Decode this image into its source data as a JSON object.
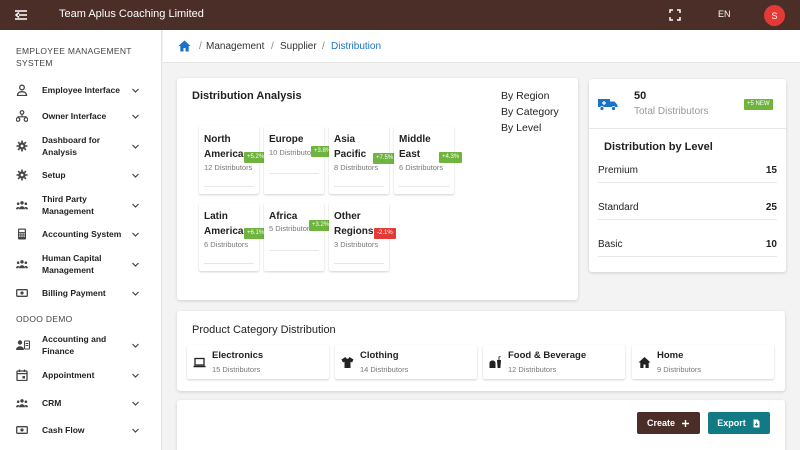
{
  "header": {
    "title": "Team Aplus Coaching Limited",
    "language": "EN",
    "avatar_initial": "S",
    "menu_icon": "menu-collapse-icon",
    "fullscreen_icon": "fullscreen-icon"
  },
  "sidebar": {
    "section_1": "EMPLOYEE MANAGEMENT SYSTEM",
    "items_1": [
      {
        "label": "Employee Interface",
        "icon": "person-icon"
      },
      {
        "label": "Owner Interface",
        "icon": "hierarchy-icon"
      },
      {
        "label": "Dashboard for Analysis",
        "icon": "gear-icon"
      },
      {
        "label": "Setup",
        "icon": "gear-icon"
      },
      {
        "label": "Third Party Management",
        "icon": "group-icon"
      },
      {
        "label": "Accounting System",
        "icon": "calculator-icon"
      },
      {
        "label": "Human Capital Management",
        "icon": "group-icon"
      },
      {
        "label": "Billing Payment",
        "icon": "money-icon"
      }
    ],
    "section_2": "ODOO DEMO",
    "items_2": [
      {
        "label": "Accounting and Finance",
        "icon": "contacts-icon"
      },
      {
        "label": "Appointment",
        "icon": "calendar-icon"
      },
      {
        "label": "CRM",
        "icon": "group-icon"
      },
      {
        "label": "Cash Flow",
        "icon": "money-icon"
      }
    ]
  },
  "breadcrumb": {
    "items": [
      "Management",
      "Supplier",
      "Distribution"
    ],
    "separator": "/"
  },
  "distribution": {
    "title": "Distribution Analysis",
    "views": [
      "By Region",
      "By Category",
      "By Level"
    ],
    "regions": [
      {
        "name": "North America",
        "count": "12 Distributors",
        "change": "+5.2%",
        "trend": "up"
      },
      {
        "name": "Europe",
        "count": "10 Distributors",
        "change": "+3.8%",
        "trend": "up"
      },
      {
        "name": "Asia Pacific",
        "count": "8 Distributors",
        "change": "+7.5%",
        "trend": "up"
      },
      {
        "name": "Middle East",
        "count": "6 Distributors",
        "change": "+4.3%",
        "trend": "up"
      },
      {
        "name": "Latin America",
        "count": "6 Distributors",
        "change": "+6.1%",
        "trend": "up"
      },
      {
        "name": "Africa",
        "count": "5 Distributors",
        "change": "+3.2%",
        "trend": "up"
      },
      {
        "name": "Other Regions",
        "count": "3 Distributors",
        "change": "-2.1%",
        "trend": "down"
      }
    ]
  },
  "summary": {
    "total": "50",
    "total_label": "Total Distributors",
    "new_badge": "+5 NEW",
    "level_title": "Distribution by Level",
    "levels": [
      {
        "name": "Premium",
        "value": "15"
      },
      {
        "name": "Standard",
        "value": "25"
      },
      {
        "name": "Basic",
        "value": "10"
      }
    ]
  },
  "product_category": {
    "title": "Product Category Distribution",
    "items": [
      {
        "name": "Electronics",
        "count": "15 Distributors",
        "icon": "laptop-icon"
      },
      {
        "name": "Clothing",
        "count": "14 Distributors",
        "icon": "shirt-icon"
      },
      {
        "name": "Food & Beverage",
        "count": "12 Distributors",
        "icon": "food-icon"
      },
      {
        "name": "Home",
        "count": "9 Distributors",
        "icon": "home-icon"
      }
    ]
  },
  "actions": {
    "create_label": "Create",
    "export_label": "Export"
  },
  "colors": {
    "topbar": "#4a2e27",
    "accent_teal": "#127a85",
    "positive": "#6fb43f",
    "negative": "#e53935",
    "link": "#1a73c8"
  }
}
